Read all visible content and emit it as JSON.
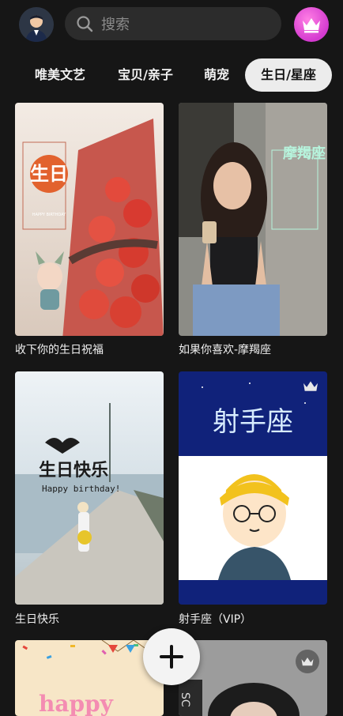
{
  "search": {
    "placeholder": "搜索"
  },
  "tabs": [
    {
      "label": "唯美文艺"
    },
    {
      "label": "宝贝/亲子"
    },
    {
      "label": "萌宠"
    },
    {
      "label": "生日/星座",
      "active": true
    }
  ],
  "cards": [
    {
      "caption": "收下你的生日祝福",
      "art_text": "生日",
      "art_small": "HAPPY BIRTHDAY",
      "vip": false
    },
    {
      "caption": "如果你喜欢-摩羯座",
      "art_text": "摩羯座",
      "vip": false
    },
    {
      "caption": "生日快乐",
      "art_text": "生日快乐",
      "art_sub": "Happy birthday!",
      "vip": false
    },
    {
      "caption": "射手座（VIP）",
      "art_text": "射手座",
      "vip": true
    },
    {
      "caption": "",
      "art_text": "happy",
      "vip": false
    },
    {
      "caption": "",
      "art_text": "SC",
      "vip": true
    }
  ],
  "icons": {
    "avatar": "user-avatar",
    "search": "search-icon",
    "vip": "crown-icon",
    "fab": "plus-icon"
  },
  "colors": {
    "background": "#161616",
    "active_tab_bg": "#ececec",
    "vip_button": "#e04ad8",
    "search_bg": "#2c2c2c"
  }
}
